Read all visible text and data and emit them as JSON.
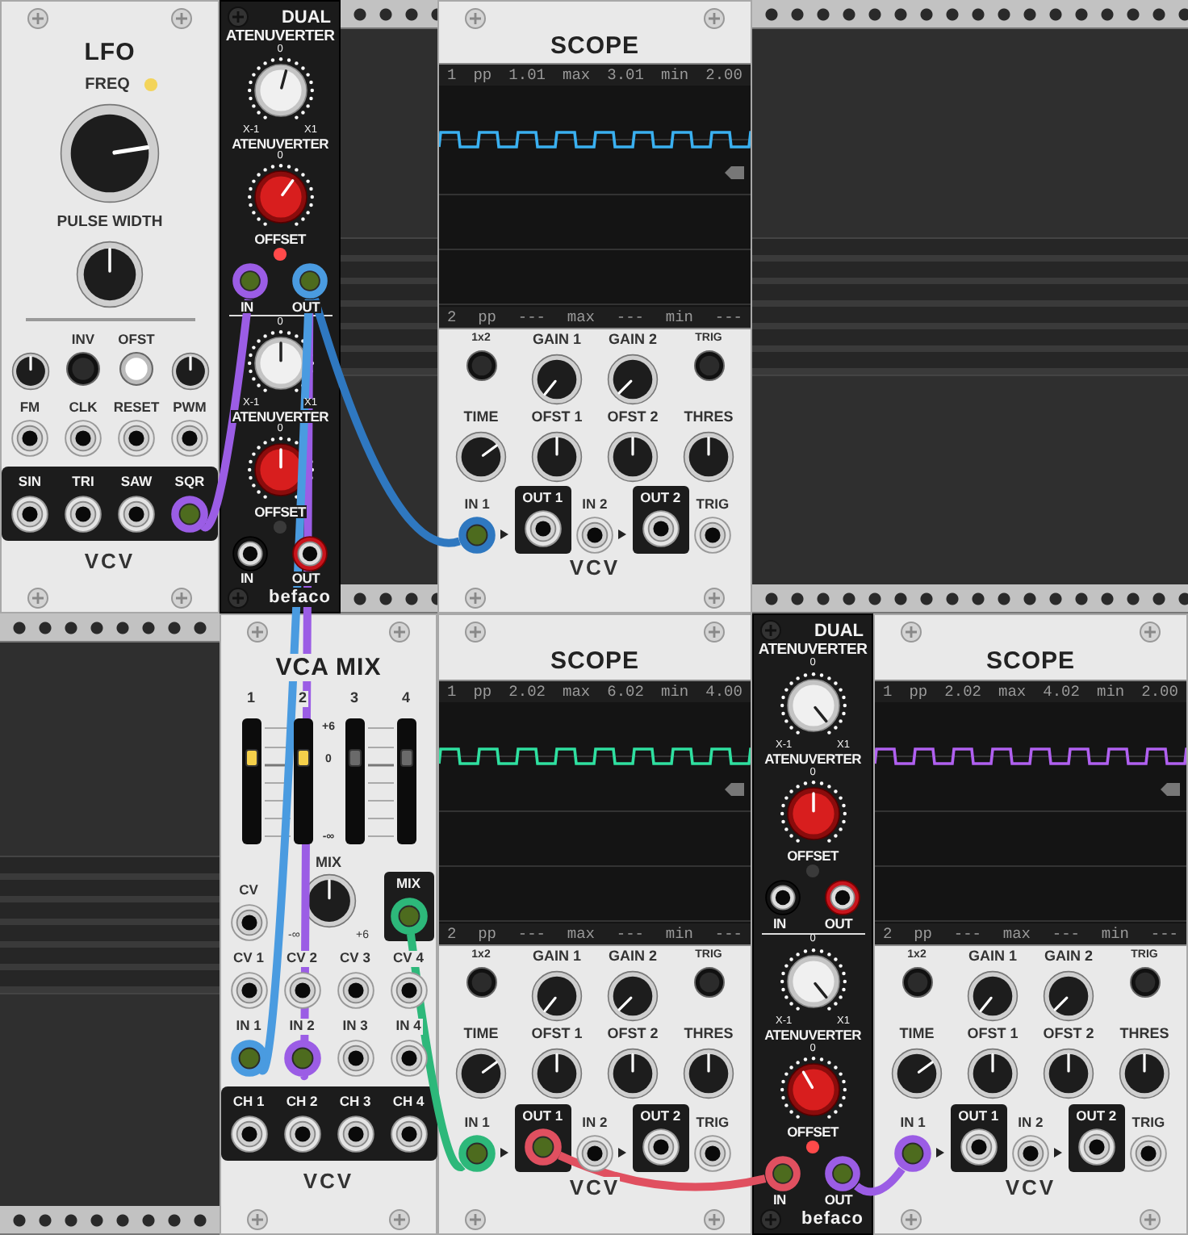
{
  "rack_rows": [
    {
      "modules": [
        {
          "kind": "lfo",
          "title": "LFO",
          "freq": {
            "label": "FREQ",
            "light": true
          },
          "pulse_width": {
            "label": "PULSE WIDTH"
          },
          "controls": [
            {
              "kind": "knob"
            },
            {
              "kind": "button",
              "label": "INV",
              "on": false
            },
            {
              "kind": "button",
              "label": "OFST",
              "on": true
            },
            {
              "kind": "knob"
            }
          ],
          "inputs": [
            "FM",
            "CLK",
            "RESET",
            "PWM"
          ],
          "outputs": [
            "SIN",
            "TRI",
            "SAW",
            "SQR"
          ],
          "logo": "VCV"
        },
        {
          "kind": "atenuverter",
          "title": "DUAL",
          "subtitle": "ATENUVERTER",
          "channels": [
            {
              "atten": {
                "zero_mark": "0",
                "min_mark": "X-1",
                "max_mark": "X1",
                "label": "ATENUVERTER"
              },
              "offset": {
                "zero_mark": "0",
                "label": "OFFSET"
              },
              "light": true,
              "in_label": "IN",
              "out_label": "OUT"
            },
            {
              "atten": {
                "zero_mark": "0",
                "min_mark": "X-1",
                "max_mark": "X1",
                "label": "ATENUVERTER"
              },
              "offset": {
                "zero_mark": "0",
                "label": "OFFSET"
              },
              "light": false,
              "in_label": "IN",
              "out_label": "OUT"
            }
          ],
          "logo": "befaco"
        },
        {
          "kind": "blank"
        },
        {
          "kind": "scope",
          "title": "SCOPE",
          "color": "#3ab0f0",
          "readout_1": [
            "1",
            "pp",
            "1.01",
            "max",
            "3.01",
            "min",
            "2.00"
          ],
          "readout_2": [
            "2",
            "pp",
            "---",
            "max",
            "---",
            "min",
            "---"
          ],
          "controls": [
            {
              "kind": "button",
              "label": "1x2"
            },
            {
              "kind": "knob",
              "label": "GAIN 1"
            },
            {
              "kind": "knob",
              "label": "GAIN 2"
            },
            {
              "kind": "button",
              "label": "TRIG"
            },
            {
              "kind": "knob",
              "label": "TIME"
            },
            {
              "kind": "knob",
              "label": "OFST 1"
            },
            {
              "kind": "knob",
              "label": "OFST 2"
            },
            {
              "kind": "knob",
              "label": "THRES"
            }
          ],
          "jacks": [
            {
              "kind": "input",
              "label": "IN 1"
            },
            {
              "kind": "output",
              "label": "OUT 1"
            },
            {
              "kind": "input",
              "label": "IN 2"
            },
            {
              "kind": "output",
              "label": "OUT 2"
            },
            {
              "kind": "input",
              "label": "TRIG"
            }
          ],
          "logo": "VCV"
        },
        {
          "kind": "blank"
        }
      ]
    },
    {
      "modules": [
        {
          "kind": "blank"
        },
        {
          "kind": "vca_mix",
          "title": "VCA MIX",
          "channels": [
            {
              "number": "1",
              "level": 0.72,
              "lit": true
            },
            {
              "number": "2",
              "level": 0.72,
              "lit": true
            },
            {
              "number": "3",
              "level": 0.72,
              "lit": false
            },
            {
              "number": "4",
              "level": 0.72,
              "lit": false
            }
          ],
          "scale": [
            "+6",
            "0",
            "-∞"
          ],
          "cv_label": "CV",
          "mix_knob": {
            "label": "MIX",
            "min_mark": "-∞",
            "max_mark": "+6"
          },
          "mix_out_label": "MIX",
          "cv_inputs": [
            "CV 1",
            "CV 2",
            "CV 3",
            "CV 4"
          ],
          "inputs": [
            "IN 1",
            "IN 2",
            "IN 3",
            "IN 4"
          ],
          "outputs": [
            "CH 1",
            "CH 2",
            "CH 3",
            "CH 4"
          ],
          "logo": "VCV"
        },
        {
          "kind": "scope",
          "title": "SCOPE",
          "color": "#2fe0a0",
          "readout_1": [
            "1",
            "pp",
            "2.02",
            "max",
            "6.02",
            "min",
            "4.00"
          ],
          "readout_2": [
            "2",
            "pp",
            "---",
            "max",
            "---",
            "min",
            "---"
          ],
          "controls": [
            {
              "kind": "button",
              "label": "1x2"
            },
            {
              "kind": "knob",
              "label": "GAIN 1"
            },
            {
              "kind": "knob",
              "label": "GAIN 2"
            },
            {
              "kind": "button",
              "label": "TRIG"
            },
            {
              "kind": "knob",
              "label": "TIME"
            },
            {
              "kind": "knob",
              "label": "OFST 1"
            },
            {
              "kind": "knob",
              "label": "OFST 2"
            },
            {
              "kind": "knob",
              "label": "THRES"
            }
          ],
          "jacks": [
            {
              "kind": "input",
              "label": "IN 1"
            },
            {
              "kind": "output",
              "label": "OUT 1"
            },
            {
              "kind": "input",
              "label": "IN 2"
            },
            {
              "kind": "output",
              "label": "OUT 2"
            },
            {
              "kind": "input",
              "label": "TRIG"
            }
          ],
          "logo": "VCV"
        },
        {
          "kind": "atenuverter",
          "title": "DUAL",
          "subtitle": "ATENUVERTER",
          "channels": [
            {
              "atten": {
                "zero_mark": "0",
                "min_mark": "X-1",
                "max_mark": "X1",
                "label": "ATENUVERTER"
              },
              "offset": {
                "zero_mark": "0",
                "label": "OFFSET"
              },
              "light": false,
              "in_label": "IN",
              "out_label": "OUT"
            },
            {
              "atten": {
                "zero_mark": "0",
                "min_mark": "X-1",
                "max_mark": "X1",
                "label": "ATENUVERTER"
              },
              "offset": {
                "zero_mark": "0",
                "label": "OFFSET"
              },
              "light": true,
              "in_label": "IN",
              "out_label": "OUT"
            }
          ],
          "logo": "befaco"
        },
        {
          "kind": "scope",
          "title": "SCOPE",
          "color": "#b060f0",
          "readout_1": [
            "1",
            "pp",
            "2.02",
            "max",
            "4.02",
            "min",
            "2.00"
          ],
          "readout_2": [
            "2",
            "pp",
            "---",
            "max",
            "---",
            "min",
            "---"
          ],
          "controls": [
            {
              "kind": "button",
              "label": "1x2"
            },
            {
              "kind": "knob",
              "label": "GAIN 1"
            },
            {
              "kind": "knob",
              "label": "GAIN 2"
            },
            {
              "kind": "button",
              "label": "TRIG"
            },
            {
              "kind": "knob",
              "label": "TIME"
            },
            {
              "kind": "knob",
              "label": "OFST 1"
            },
            {
              "kind": "knob",
              "label": "OFST 2"
            },
            {
              "kind": "knob",
              "label": "THRES"
            }
          ],
          "jacks": [
            {
              "kind": "input",
              "label": "IN 1"
            },
            {
              "kind": "output",
              "label": "OUT 1"
            },
            {
              "kind": "input",
              "label": "IN 2"
            },
            {
              "kind": "output",
              "label": "OUT 2"
            },
            {
              "kind": "input",
              "label": "TRIG"
            }
          ],
          "logo": "VCV"
        }
      ]
    }
  ],
  "cables": [
    {
      "color": "#9b5de5"
    },
    {
      "color": "#9b5de5"
    },
    {
      "color": "#2f78c0"
    },
    {
      "color": "#4a9be0"
    },
    {
      "color": "#2db87a"
    },
    {
      "color": "#e05060"
    },
    {
      "color": "#9b5de5"
    }
  ]
}
